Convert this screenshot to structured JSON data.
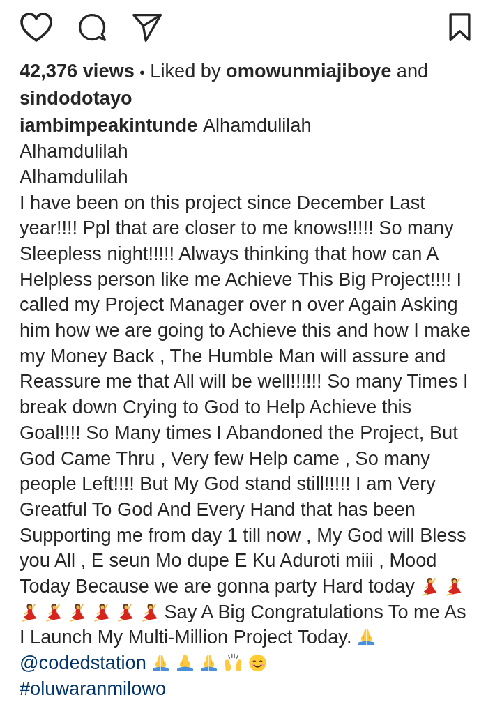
{
  "post_actions": {
    "liked": false,
    "saved": false
  },
  "stats": {
    "views": "42,376 views",
    "separator": "•",
    "liked_by_label": "Liked by",
    "liked_by": [
      "omowunmiajiboye",
      "sindodotayo"
    ],
    "conjunction": "and"
  },
  "caption": {
    "paragraphs": [
      [
        {
          "kind": "username",
          "text": "iambimpeakintunde"
        },
        {
          "kind": "text",
          "text": "Alhamdulilah"
        }
      ],
      [
        {
          "kind": "text",
          "text": "Alhamdulilah"
        }
      ],
      [
        {
          "kind": "text",
          "text": "Alhamdulilah"
        }
      ],
      [
        {
          "kind": "text",
          "text": "I have been on this project since December Last year!!!! Ppl that are closer to me knows!!!!! So many Sleepless night!!!!! Always thinking that how can A Helpless person like me Achieve This Big Project!!!! I called my Project Manager over n over Again Asking him how we are going to Achieve this and how I make my Money Back , The Humble Man will assure and Reassure me that All will be well!!!!!! So many Times I break down Crying to God to Help Achieve this Goal!!!! So Many times I Abandoned the Project, But God Came Thru , Very few Help came , So many people Left!!!! But My God stand still!!!!! I am Very Greatful To God And Every Hand that has been Supporting me from day 1 till now , My God will Bless you All , E seun Mo dupe E Ku Aduroti miii , Mood"
        },
        {
          "kind": "text",
          "text": "Today Because we are gonna party Hard today"
        },
        {
          "kind": "dancer"
        },
        {
          "kind": "dancer"
        },
        {
          "kind": "dancer"
        },
        {
          "kind": "dancer"
        },
        {
          "kind": "dancer"
        },
        {
          "kind": "dancer"
        },
        {
          "kind": "dancer"
        },
        {
          "kind": "dancer"
        },
        {
          "kind": "text",
          "text": "Say A Big Congratulations To me As"
        },
        {
          "kind": "text",
          "text": "I Launch My Multi-Million Project Today."
        },
        {
          "kind": "pray"
        }
      ],
      [
        {
          "kind": "mention",
          "text": "@codedstation"
        },
        {
          "kind": "pray"
        },
        {
          "kind": "pray"
        },
        {
          "kind": "pray"
        },
        {
          "kind": "raised"
        },
        {
          "kind": "smile"
        }
      ],
      [
        {
          "kind": "hashtag",
          "text": "#oluwaranmilowo"
        }
      ]
    ]
  }
}
